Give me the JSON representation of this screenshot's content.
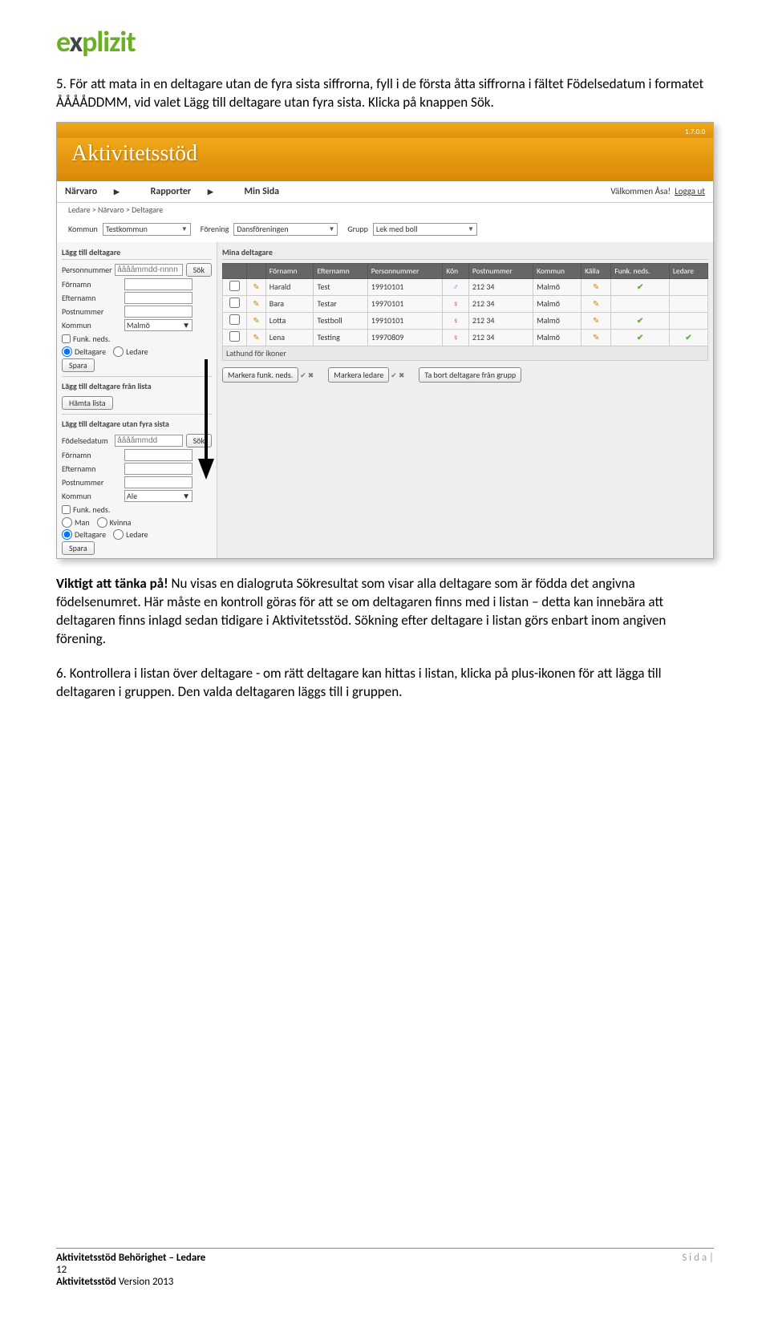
{
  "logo": {
    "part1": "e",
    "part2": "x",
    "part3": "plizit"
  },
  "paragraphs": {
    "p1": "5. För att mata in en deltagare utan de fyra sista siffrorna, fyll i de första åtta siffrorna i fältet Födelsedatum i formatet ÅÅÅÅDDMM, vid valet Lägg till deltagare utan fyra sista. Klicka på knappen Sök.",
    "p2_lead": "Viktigt att tänka på!",
    "p2_rest": " Nu visas en dialogruta Sökresultat som visar alla deltagare som är födda det angivna födelsenumret. Här måste en kontroll göras för att se om deltagaren finns med i listan – detta kan innebära att deltagaren finns inlagd sedan tidigare i Aktivitetsstöd. Sökning efter deltagare i listan görs enbart inom angiven förening.",
    "p3": "6. Kontrollera i listan över deltagare - om rätt deltagare kan hittas i listan, klicka på plus-ikonen för att lägga till deltagaren i gruppen. Den valda deltagaren läggs till i gruppen."
  },
  "screenshot": {
    "version": "1.7.0.0",
    "app_title": "Aktivitetsstöd",
    "nav": {
      "narvaro": "Närvaro",
      "rapporter": "Rapporter",
      "minsida": "Min Sida"
    },
    "welcome": "Välkommen Åsa!",
    "logout": "Logga ut",
    "breadcrumb": "Ledare > Närvaro > Deltagare",
    "filters": {
      "kommun_label": "Kommun",
      "kommun_value": "Testkommun",
      "forening_label": "Förening",
      "forening_value": "Dansföreningen",
      "grupp_label": "Grupp",
      "grupp_value": "Lek med boll"
    },
    "left": {
      "sec1_title": "Lägg till deltagare",
      "personnummer_label": "Personnummer",
      "personnummer_ph": "ååååmmdd-nnnn",
      "sok": "Sök",
      "fornamn": "Förnamn",
      "efternamn": "Efternamn",
      "postnummer": "Postnummer",
      "kommun": "Kommun",
      "kommun_val1": "Malmö",
      "funk": "Funk. neds.",
      "deltagare": "Deltagare",
      "ledare": "Ledare",
      "spara": "Spara",
      "sec2_title": "Lägg till deltagare från lista",
      "hamta": "Hämta lista",
      "sec3_title": "Lägg till deltagare utan fyra sista",
      "fodelsedatum": "Födelsedatum",
      "fodelsedatum_ph": "ååååmmdd",
      "kommun_val2": "Ale",
      "man": "Man",
      "kvinna": "Kvinna"
    },
    "table": {
      "title": "Mina deltagare",
      "headers": [
        "",
        "",
        "Förnamn",
        "Efternamn",
        "Personnummer",
        "Kön",
        "Postnummer",
        "Kommun",
        "Källa",
        "Funk. neds.",
        "Ledare"
      ],
      "rows": [
        {
          "fn": "Harald",
          "en": "Test",
          "pn": "19910101",
          "kon": "m",
          "post": "212 34",
          "kom": "Malmö",
          "funk": true,
          "led": false
        },
        {
          "fn": "Bara",
          "en": "Testar",
          "pn": "19970101",
          "kon": "f",
          "post": "212 34",
          "kom": "Malmö",
          "funk": false,
          "led": false
        },
        {
          "fn": "Lotta",
          "en": "Testboll",
          "pn": "19910101",
          "kon": "f",
          "post": "212 34",
          "kom": "Malmö",
          "funk": true,
          "led": false
        },
        {
          "fn": "Lena",
          "en": "Testing",
          "pn": "19970809",
          "kon": "f",
          "post": "212 34",
          "kom": "Malmö",
          "funk": true,
          "led": true
        }
      ],
      "lathund": "Lathund för ikoner"
    },
    "buttons": {
      "markera_funk": "Markera funk. neds.",
      "markera_ledare": "Markera ledare",
      "ta_bort": "Ta bort deltagare från grupp"
    }
  },
  "footer": {
    "left_line1": "Aktivitetsstöd Behörighet – Ledare",
    "left_line2a": "12",
    "left_line2b": "Aktivitetsstöd",
    "left_line2c": " Version 2013",
    "right": "S i d a  |"
  }
}
